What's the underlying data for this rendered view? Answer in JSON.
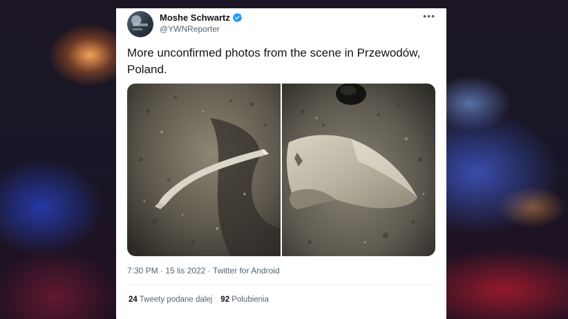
{
  "tweet": {
    "author_name": "Moshe Schwartz",
    "handle": "@YWNReporter",
    "verified_icon": "verified-badge-icon",
    "more_icon": "more-dots-icon",
    "more_label": "•••",
    "text": "More unconfirmed photos from the scene in Przewodów, Poland.",
    "photos": [
      {
        "name": "photo-metal-debris-strip"
      },
      {
        "name": "photo-metal-debris-fragment"
      }
    ],
    "time": "7:30 PM",
    "date": "15 lis 2022",
    "separator": "·",
    "source": "Twitter for Android",
    "retweets_count": "24",
    "retweets_label": "Tweety podane dalej",
    "likes_count": "92",
    "likes_label": "Polubienia"
  },
  "colors": {
    "verified": "#1d9bf0",
    "text_primary": "#0f1419",
    "text_secondary": "#536471"
  }
}
